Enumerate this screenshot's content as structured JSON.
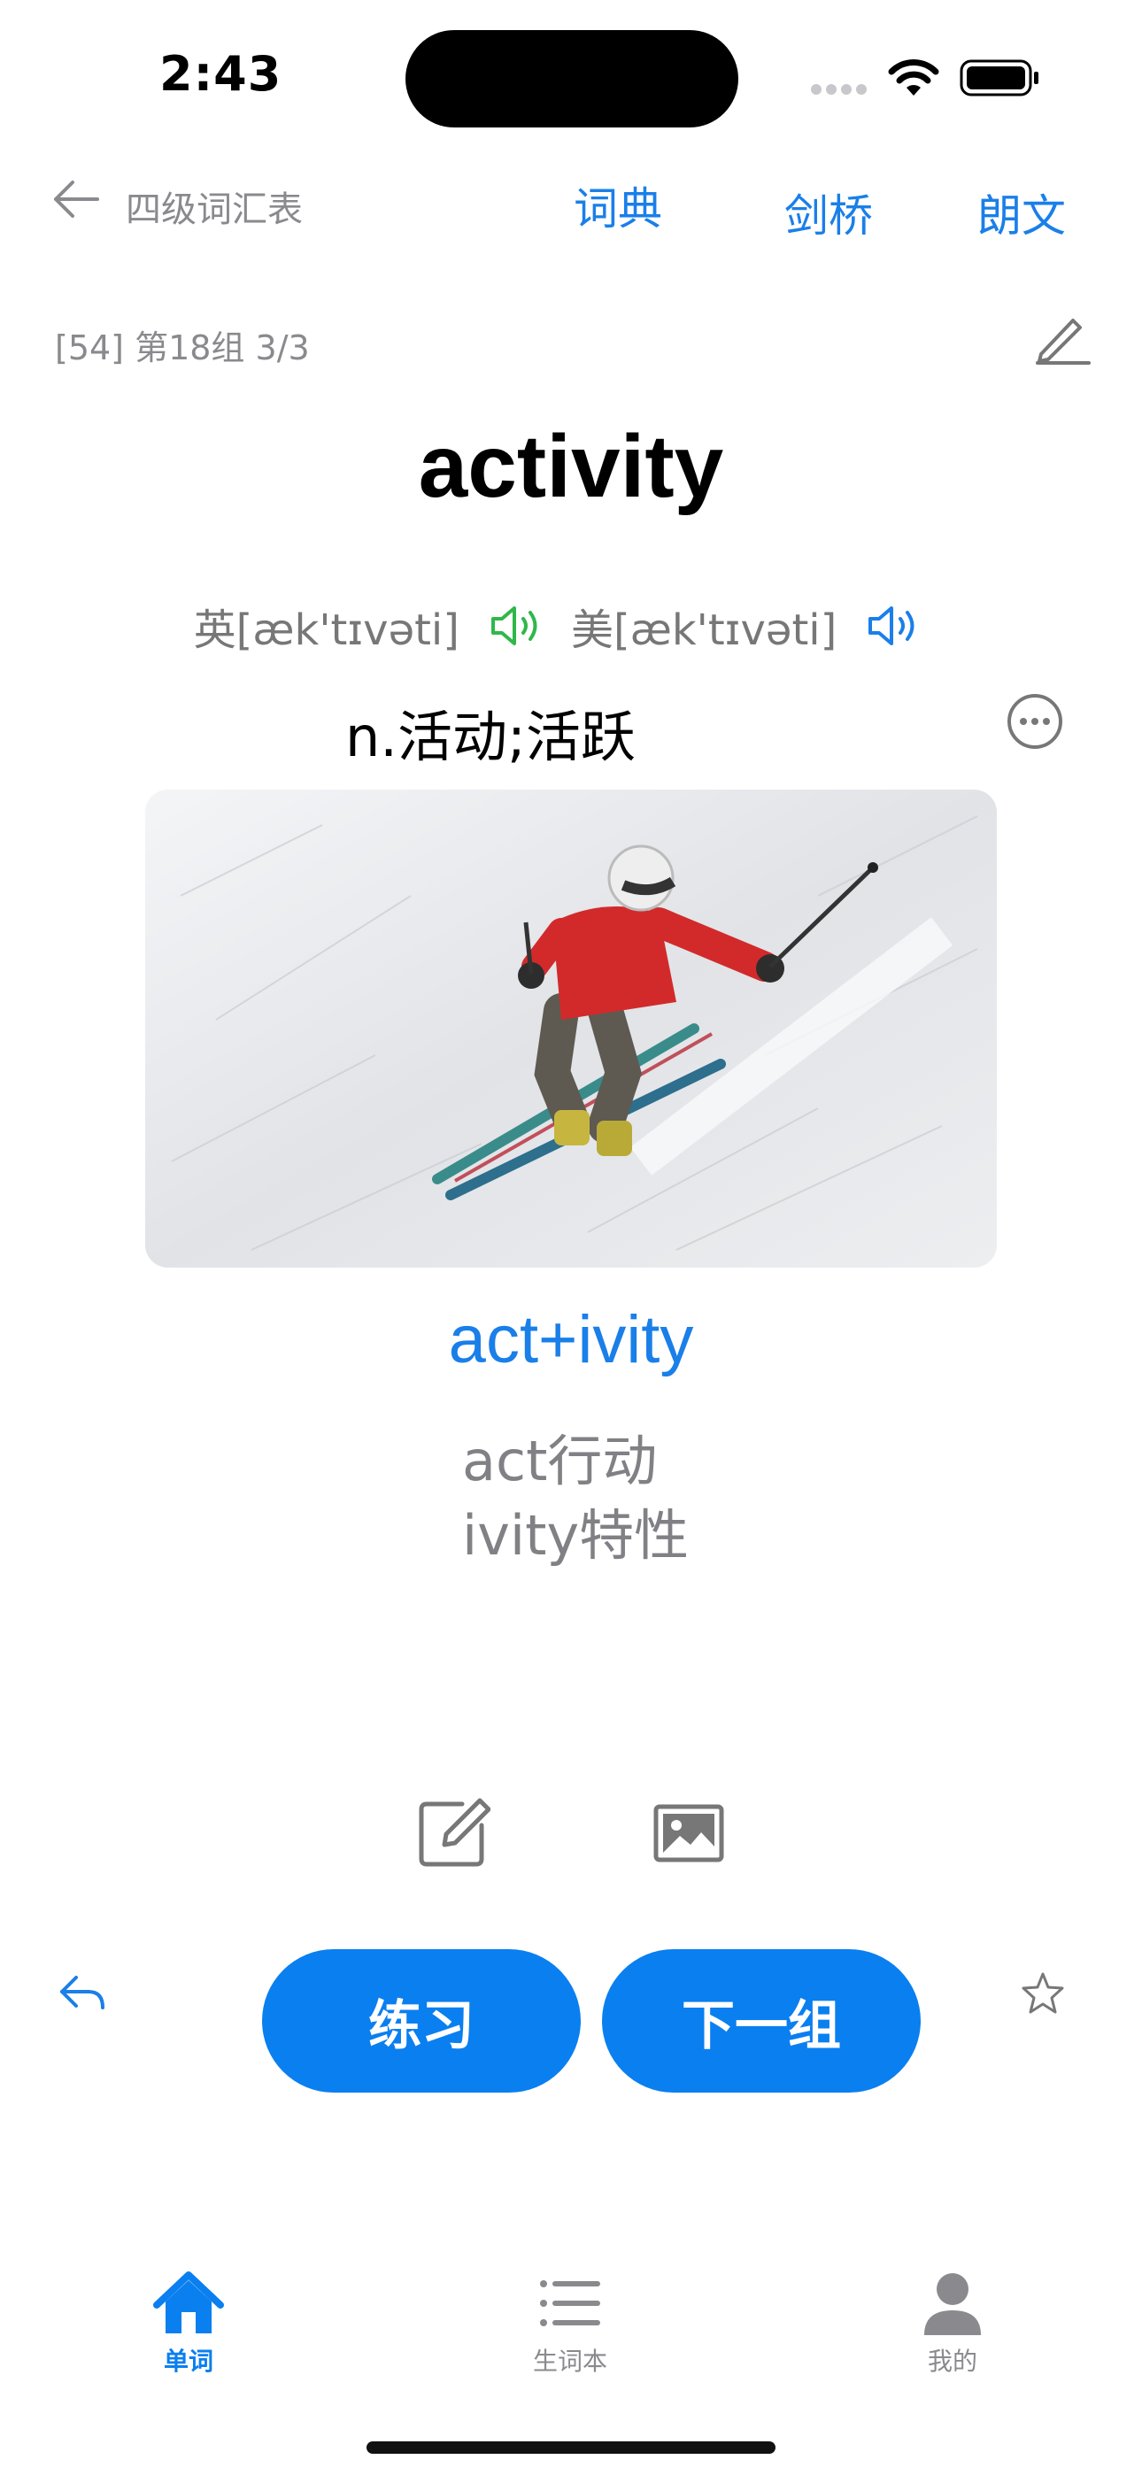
{
  "status_bar": {
    "time": "2:43"
  },
  "nav": {
    "back_label": "四级词汇表",
    "tabs": [
      {
        "label": "词典"
      },
      {
        "label": "剑桥"
      },
      {
        "label": "朗文"
      }
    ]
  },
  "progress": "[54] 第18组 3/3",
  "word": "activity",
  "phonetics": {
    "uk": "英[æk'tɪvəti]",
    "us": "美[æk'tɪvəti]",
    "uk_speaker_color": "#2fb84a",
    "us_speaker_color": "#1a7fe8"
  },
  "meaning": "n.活动;活跃",
  "root": {
    "formula": "act+ivity",
    "parts": [
      "act行动",
      "ivity特性"
    ]
  },
  "actions": {
    "practice_label": "练习",
    "next_group_label": "下一组"
  },
  "tabbar": {
    "items": [
      {
        "label": "单词",
        "icon": "home-icon",
        "active": true
      },
      {
        "label": "生词本",
        "icon": "list-icon",
        "active": false
      },
      {
        "label": "我的",
        "icon": "person-icon",
        "active": false
      }
    ]
  },
  "colors": {
    "accent": "#0a7ff0",
    "secondary_text": "#8a8a8e"
  },
  "icons": [
    "back-arrow-icon",
    "pencil-icon",
    "speaker-icon",
    "more-icon",
    "edit-note-icon",
    "image-icon",
    "undo-icon",
    "star-icon"
  ]
}
